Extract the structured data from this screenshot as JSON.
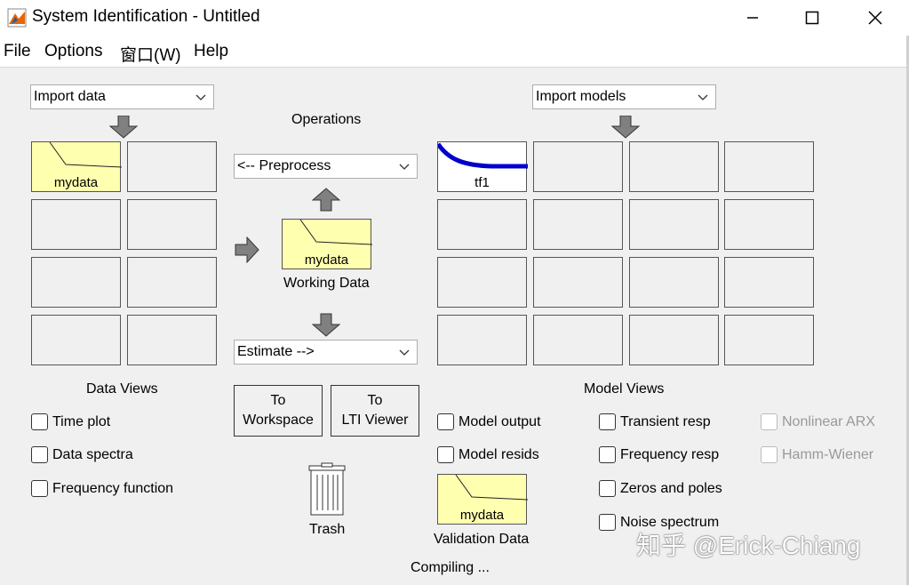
{
  "window": {
    "title": "System Identification - Untitled",
    "minimize_icon": "minimize-icon",
    "maximize_icon": "maximize-icon",
    "close_icon": "close-icon"
  },
  "menu": {
    "file": "File",
    "options": "Options",
    "window": "窗口(W)",
    "help": "Help"
  },
  "data_panel": {
    "import_label": "Import data",
    "cells": [
      "mydata",
      "",
      "",
      "",
      "",
      "",
      "",
      ""
    ],
    "views_title": "Data Views",
    "views": [
      "Time plot",
      "Data spectra",
      "Frequency function"
    ]
  },
  "operations": {
    "title": "Operations",
    "preprocess_label": "<-- Preprocess",
    "working_data_name": "mydata",
    "working_data_label": "Working Data",
    "estimate_label": "Estimate -->",
    "to_workspace": [
      "To",
      "Workspace"
    ],
    "to_lti_viewer": [
      "To",
      "LTI Viewer"
    ],
    "trash_label": "Trash",
    "validation_data_name": "mydata",
    "validation_data_label": "Validation Data",
    "status": "Compiling ..."
  },
  "model_panel": {
    "import_label": "Import models",
    "cells": [
      "tf1",
      "",
      "",
      "",
      "",
      "",
      "",
      "",
      "",
      "",
      "",
      "",
      "",
      "",
      "",
      ""
    ],
    "views_title": "Model Views",
    "views_col1": [
      "Model output",
      "Model resids"
    ],
    "views_col2": [
      "Transient resp",
      "Frequency resp",
      "Zeros and poles",
      "Noise spectrum"
    ],
    "views_col3": [
      "Nonlinear ARX",
      "Hamm-Wiener"
    ]
  },
  "watermark": "知乎 @Erick-Chiang",
  "colors": {
    "data_fill": "#ffffb0",
    "model_curve": "#0000cc",
    "accent_icon": "#e8650a"
  }
}
